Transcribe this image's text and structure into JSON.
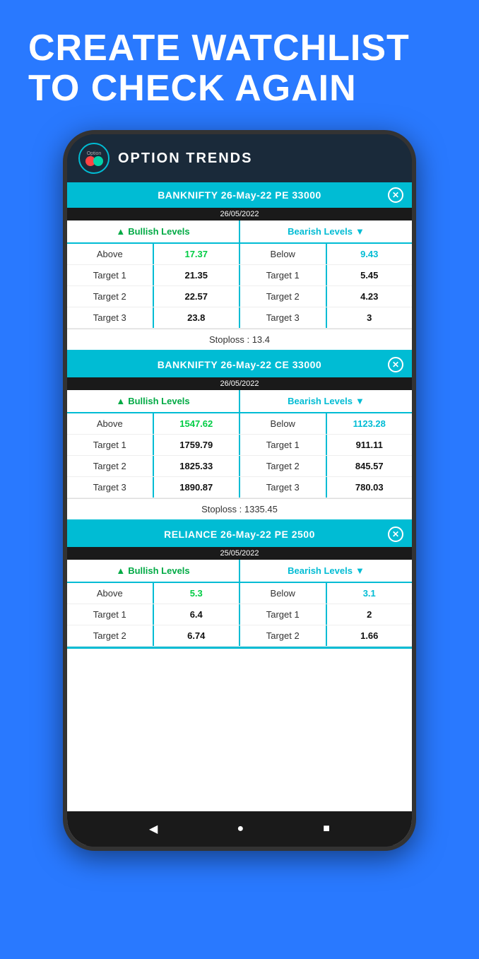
{
  "hero": {
    "line1": "CREATE WATCHLIST",
    "line2": "TO CHECK AGAIN"
  },
  "app": {
    "title": "OPTION TRENDS"
  },
  "cards": [
    {
      "id": "card1",
      "title": "BANKNIFTY 26-May-22 PE 33000",
      "date": "26/05/2022",
      "bullish_label": "Bullish Levels",
      "bearish_label": "Bearish Levels",
      "rows": [
        {
          "bull_label": "Above",
          "bull_value": "17.37",
          "bull_class": "green",
          "bear_label": "Below",
          "bear_value": "9.43",
          "bear_class": "blue"
        },
        {
          "bull_label": "Target 1",
          "bull_value": "21.35",
          "bull_class": "dark",
          "bear_label": "Target 1",
          "bear_value": "5.45",
          "bear_class": "dark"
        },
        {
          "bull_label": "Target 2",
          "bull_value": "22.57",
          "bull_class": "dark",
          "bear_label": "Target 2",
          "bear_value": "4.23",
          "bear_class": "dark"
        },
        {
          "bull_label": "Target 3",
          "bull_value": "23.8",
          "bull_class": "dark",
          "bear_label": "Target 3",
          "bear_value": "3",
          "bear_class": "dark"
        }
      ],
      "stoploss_label": "Stoploss :",
      "stoploss_value": "13.4"
    },
    {
      "id": "card2",
      "title": "BANKNIFTY 26-May-22 CE 33000",
      "date": "26/05/2022",
      "bullish_label": "Bullish Levels",
      "bearish_label": "Bearish Levels",
      "rows": [
        {
          "bull_label": "Above",
          "bull_value": "1547.62",
          "bull_class": "green",
          "bear_label": "Below",
          "bear_value": "1123.28",
          "bear_class": "blue"
        },
        {
          "bull_label": "Target 1",
          "bull_value": "1759.79",
          "bull_class": "dark",
          "bear_label": "Target 1",
          "bear_value": "911.11",
          "bear_class": "dark"
        },
        {
          "bull_label": "Target 2",
          "bull_value": "1825.33",
          "bull_class": "dark",
          "bear_label": "Target 2",
          "bear_value": "845.57",
          "bear_class": "dark"
        },
        {
          "bull_label": "Target 3",
          "bull_value": "1890.87",
          "bull_class": "dark",
          "bear_label": "Target 3",
          "bear_value": "780.03",
          "bear_class": "dark"
        }
      ],
      "stoploss_label": "Stoploss :",
      "stoploss_value": "1335.45"
    },
    {
      "id": "card3",
      "title": "RELIANCE 26-May-22 PE 2500",
      "date": "25/05/2022",
      "bullish_label": "Bullish Levels",
      "bearish_label": "Bearish Levels",
      "rows": [
        {
          "bull_label": "Above",
          "bull_value": "5.3",
          "bull_class": "green",
          "bear_label": "Below",
          "bear_value": "3.1",
          "bear_class": "blue"
        },
        {
          "bull_label": "Target 1",
          "bull_value": "6.4",
          "bull_class": "dark",
          "bear_label": "Target 1",
          "bear_value": "2",
          "bear_class": "dark"
        },
        {
          "bull_label": "Target 2",
          "bull_value": "6.74",
          "bull_class": "dark",
          "bear_label": "Target 2",
          "bear_value": "1.66",
          "bear_class": "dark"
        }
      ],
      "stoploss_label": null,
      "stoploss_value": null
    }
  ],
  "nav": {
    "back": "◀",
    "home": "●",
    "recent": "■"
  }
}
